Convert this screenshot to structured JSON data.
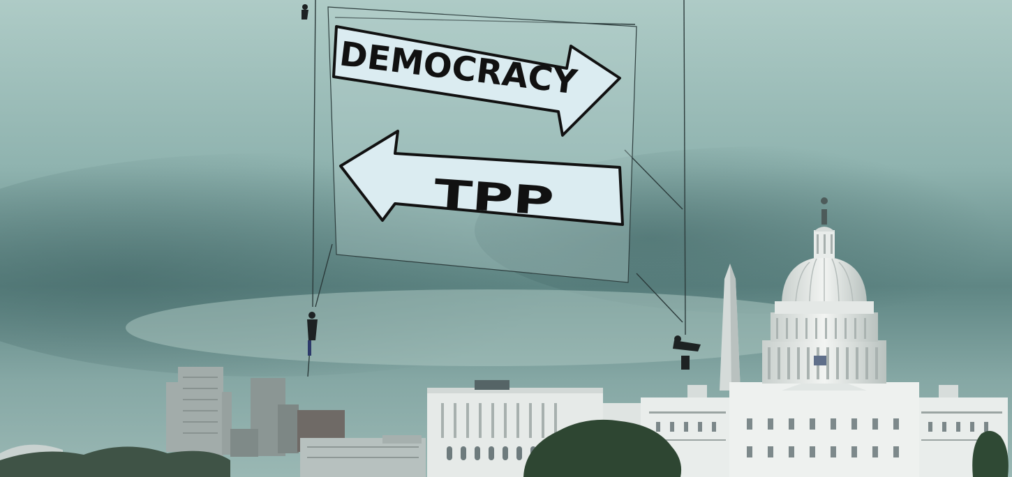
{
  "banner": {
    "top_arrow_text": "DEMOCRACY",
    "bottom_arrow_text": "TPP"
  },
  "colors": {
    "sky_top": "#a9c7c2",
    "sky_mid": "#7a9e9c",
    "sky_dark": "#4f7474",
    "banner_fabric": "#b9d3d0",
    "arrow_fill": "#dfeef2",
    "arrow_outline": "#111111",
    "capitol_white": "#e8ecea",
    "monument": "#d9dedc",
    "trees": "#2f4a35",
    "city_buildings": "#9aa6a4"
  }
}
